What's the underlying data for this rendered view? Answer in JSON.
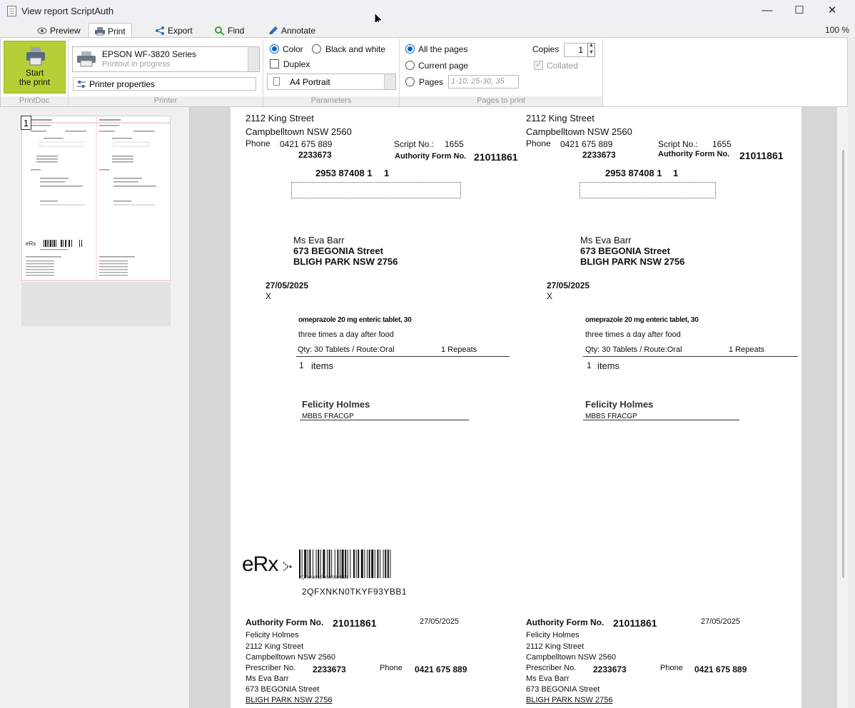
{
  "window": {
    "title": "View report ScriptAuth",
    "minimize": "—",
    "maximize": "☐",
    "close": "✕"
  },
  "tabs": [
    {
      "label": "Preview",
      "icon": "eye-icon"
    },
    {
      "label": "Print",
      "icon": "printer-icon"
    },
    {
      "label": "Export",
      "icon": "share-icon"
    },
    {
      "label": "Find",
      "icon": "search-icon"
    },
    {
      "label": "Annotate",
      "icon": "pencil-icon"
    }
  ],
  "zoom": "100 %",
  "ribbon": {
    "start_print": {
      "line1": "Start",
      "line2": "the print"
    },
    "printer": {
      "name": "EPSON WF-3820 Series",
      "status": "Printout in progress",
      "properties_label": "Printer properties"
    },
    "parameters": {
      "color_label": "Color",
      "bw_label": "Black and white",
      "duplex_label": "Duplex",
      "paper": "A4 Portrait"
    },
    "pages": {
      "all_label": "All the pages",
      "current_label": "Current page",
      "pages_label": "Pages",
      "pages_placeholder": "1-10, 25-30, 35",
      "copies_label": "Copies",
      "copies_value": "1",
      "collated_label": "Collated"
    },
    "groups": {
      "printdoc": "PrintDoc",
      "printer": "Printer",
      "parameters": "Parameters",
      "pages_to_print": "Pages to print"
    }
  },
  "thumbnail": {
    "page_number": "1"
  },
  "script": {
    "street": "2112 King Street",
    "suburb": "Campbelltown NSW 2560",
    "phone_label": "Phone",
    "phone": "0421 675 889",
    "script_no_label": "Script No.:",
    "script_no": "1655",
    "prescriber_no": "2233673",
    "authority_label": "Authority Form No.",
    "authority_no": "21011861",
    "medicare": "2953 87408 1",
    "medicare_ref": "1",
    "patient_name": "Ms Eva Barr",
    "patient_street": "673 BEGONIA Street",
    "patient_suburb": "BLIGH PARK NSW 2756",
    "date": "27/05/2025",
    "x_mark": "X",
    "drug": "omeprazole 20 mg enteric tablet, 30",
    "directions": "three times a day after food",
    "qty_route": "Qty: 30 Tablets / Route:Oral",
    "repeats": "1 Repeats",
    "items_count": "1",
    "items_label": "items",
    "doctor": "Felicity Holmes",
    "qualifications": "MBBS FRACGP",
    "erx_logo": "eRx",
    "erx_code": "2QFXNKN0TKYF93YBB1",
    "barcode_small": "2QFXNKN0TKYF93YBB1"
  },
  "authority_copy": {
    "title_label": "Authority Form No.",
    "number": "21011861",
    "date": "27/05/2025",
    "doctor": "Felicity Holmes",
    "street": "2112 King Street",
    "suburb": "Campbelltown NSW 2560",
    "prescriber_label": "Prescriber No.",
    "prescriber_no": "2233673",
    "phone_label": "Phone",
    "phone": "0421 675 889",
    "patient_name": "Ms Eva Barr",
    "patient_street": "673 BEGONIA Street",
    "patient_suburb": "BLIGH PARK NSW 2756"
  }
}
